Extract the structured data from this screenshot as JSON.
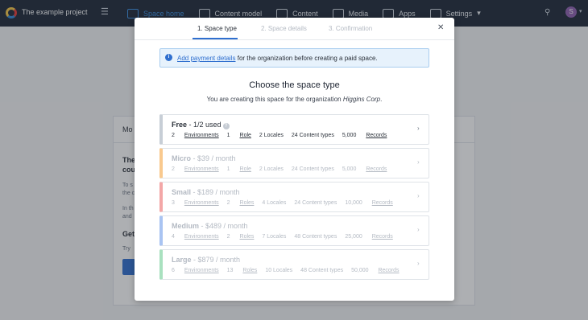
{
  "topbar": {
    "project": "The example project",
    "nav": [
      "Space home",
      "Content model",
      "Content",
      "Media",
      "Apps",
      "Settings"
    ],
    "avatar": "S"
  },
  "background": {
    "head": "Mo",
    "l1": "The",
    "l2": "cou",
    "l3": "To s",
    "l4": "the c",
    "l5": "In th",
    "l6": "and",
    "l7": "Get",
    "l8": "Try"
  },
  "modal": {
    "steps": [
      "1. Space type",
      "2. Space details",
      "3. Confirmation"
    ],
    "notice": {
      "link": "Add payment details",
      "text": " for the organization before creating a paid space."
    },
    "title": "Choose the space type",
    "subtitle_prefix": "You are creating this space for the organization ",
    "org": "Higgins Corp",
    "subtitle_suffix": ".",
    "plans": [
      {
        "name": "Free",
        "price": " - 1/2 used",
        "color": "#c7ced6",
        "disabled": false,
        "environments": "2",
        "env_label": "Environments",
        "roles": "1",
        "role_label": "Role",
        "locales": "2 Locales",
        "ctypes": "24 Content types",
        "records": "5,000",
        "rec_label": "Records"
      },
      {
        "name": "Micro",
        "price": " - $39 / month",
        "color": "#f9c98e",
        "disabled": true,
        "environments": "2",
        "env_label": "Environments",
        "roles": "1",
        "role_label": "Role",
        "locales": "2 Locales",
        "ctypes": "24 Content types",
        "records": "5,000",
        "rec_label": "Records"
      },
      {
        "name": "Small",
        "price": " - $189 / month",
        "color": "#f3a7a7",
        "disabled": true,
        "environments": "3",
        "env_label": "Environments",
        "roles": "2",
        "role_label": "Roles",
        "locales": "4 Locales",
        "ctypes": "24 Content types",
        "records": "10,000",
        "rec_label": "Records"
      },
      {
        "name": "Medium",
        "price": " - $489 / month",
        "color": "#a9c4f2",
        "disabled": true,
        "environments": "4",
        "env_label": "Environments",
        "roles": "2",
        "role_label": "Roles",
        "locales": "7 Locales",
        "ctypes": "48 Content types",
        "records": "25,000",
        "rec_label": "Records"
      },
      {
        "name": "Large",
        "price": " - $879 / month",
        "color": "#a9e1bf",
        "disabled": true,
        "environments": "6",
        "env_label": "Environments",
        "roles": "13",
        "role_label": "Roles",
        "locales": "10 Locales",
        "ctypes": "48 Content types",
        "records": "50,000",
        "rec_label": "Records"
      }
    ]
  }
}
